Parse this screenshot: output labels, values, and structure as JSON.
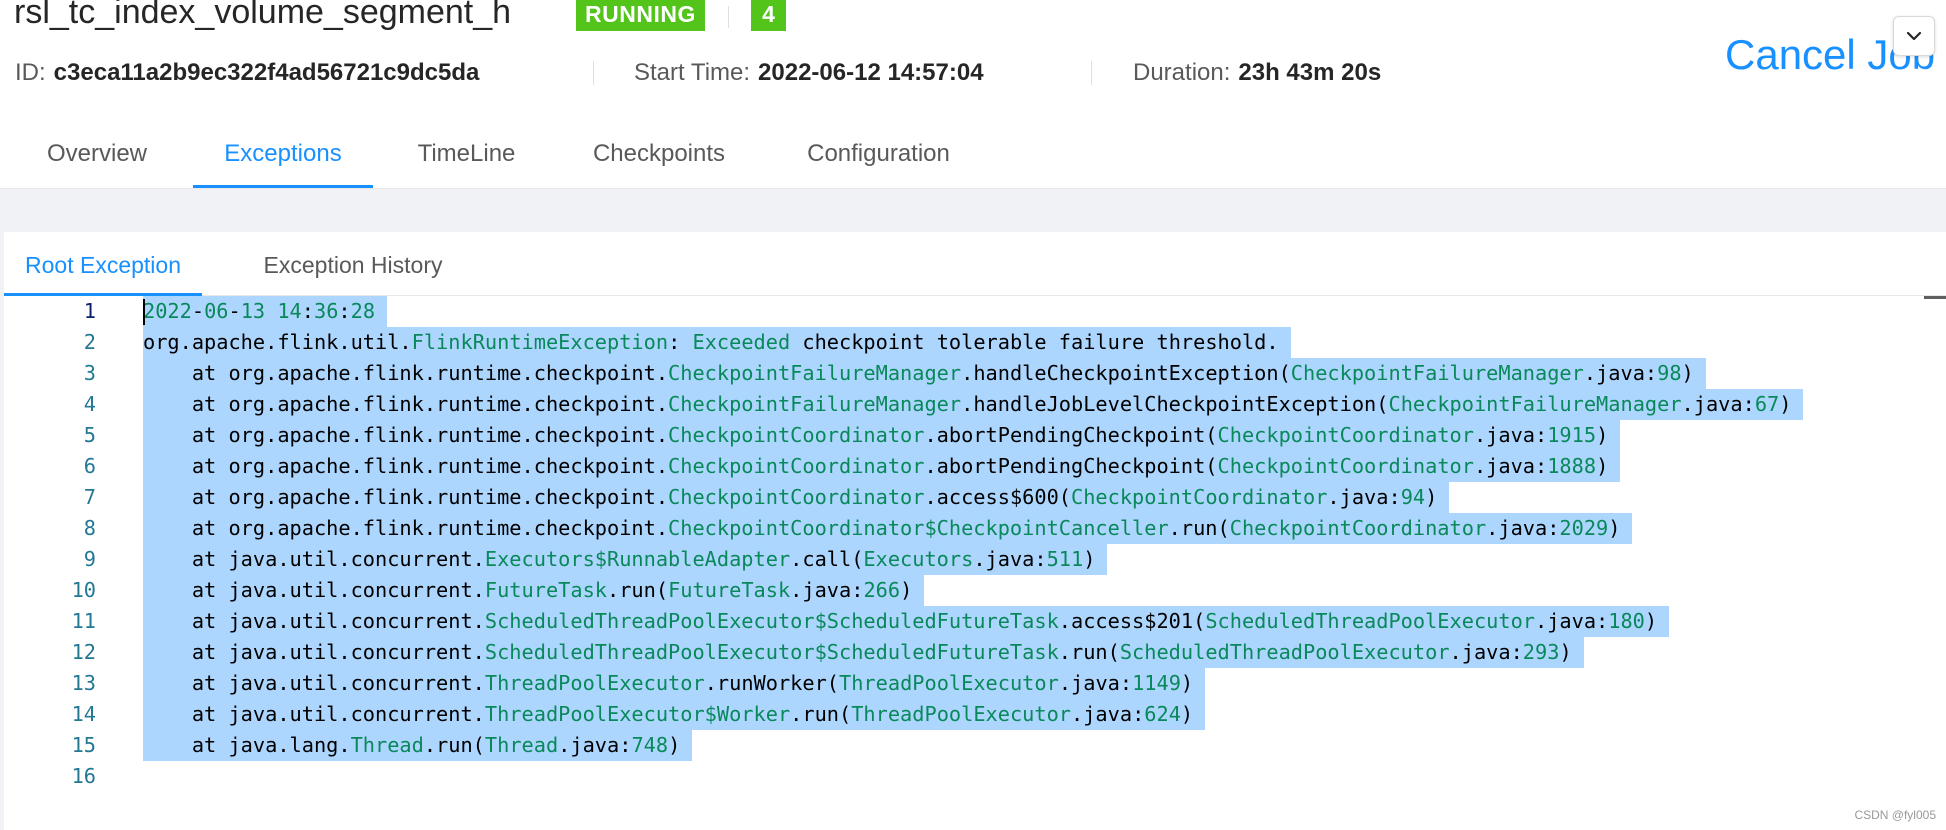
{
  "job": {
    "title": "rsl_tc_index_volume_segment_h",
    "status": "RUNNING",
    "task_count": "4",
    "id_label": "ID:",
    "id_value": "c3eca11a2b9ec322f4ad56721c9dc5da",
    "start_label": "Start Time:",
    "start_value": "2022-06-12 14:57:04",
    "duration_label": "Duration:",
    "duration_value": "23h 43m 20s",
    "cancel_label": "Cancel Job"
  },
  "colors": {
    "accent": "#1890ff",
    "status_running": "#52c41a",
    "selection": "#add6ff",
    "code_green": "#09885a",
    "line_number": "#237893"
  },
  "main_tabs": [
    {
      "label": "Overview",
      "active": false
    },
    {
      "label": "Exceptions",
      "active": true
    },
    {
      "label": "TimeLine",
      "active": false
    },
    {
      "label": "Checkpoints",
      "active": false
    },
    {
      "label": "Configuration",
      "active": false
    }
  ],
  "sub_tabs": [
    {
      "label": "Root Exception",
      "active": true
    },
    {
      "label": "Exception History",
      "active": false
    }
  ],
  "exception_lines": [
    "2022-06-13 14:36:28",
    "org.apache.flink.util.FlinkRuntimeException: Exceeded checkpoint tolerable failure threshold.",
    "    at org.apache.flink.runtime.checkpoint.CheckpointFailureManager.handleCheckpointException(CheckpointFailureManager.java:98)",
    "    at org.apache.flink.runtime.checkpoint.CheckpointFailureManager.handleJobLevelCheckpointException(CheckpointFailureManager.java:67)",
    "    at org.apache.flink.runtime.checkpoint.CheckpointCoordinator.abortPendingCheckpoint(CheckpointCoordinator.java:1915)",
    "    at org.apache.flink.runtime.checkpoint.CheckpointCoordinator.abortPendingCheckpoint(CheckpointCoordinator.java:1888)",
    "    at org.apache.flink.runtime.checkpoint.CheckpointCoordinator.access$600(CheckpointCoordinator.java:94)",
    "    at org.apache.flink.runtime.checkpoint.CheckpointCoordinator$CheckpointCanceller.run(CheckpointCoordinator.java:2029)",
    "    at java.util.concurrent.Executors$RunnableAdapter.call(Executors.java:511)",
    "    at java.util.concurrent.FutureTask.run(FutureTask.java:266)",
    "    at java.util.concurrent.ScheduledThreadPoolExecutor$ScheduledFutureTask.access$201(ScheduledThreadPoolExecutor.java:180)",
    "    at java.util.concurrent.ScheduledThreadPoolExecutor$ScheduledFutureTask.run(ScheduledThreadPoolExecutor.java:293)",
    "    at java.util.concurrent.ThreadPoolExecutor.runWorker(ThreadPoolExecutor.java:1149)",
    "    at java.util.concurrent.ThreadPoolExecutor$Worker.run(ThreadPoolExecutor.java:624)",
    "    at java.lang.Thread.run(Thread.java:748)",
    ""
  ],
  "watermark": "CSDN @fyl005"
}
